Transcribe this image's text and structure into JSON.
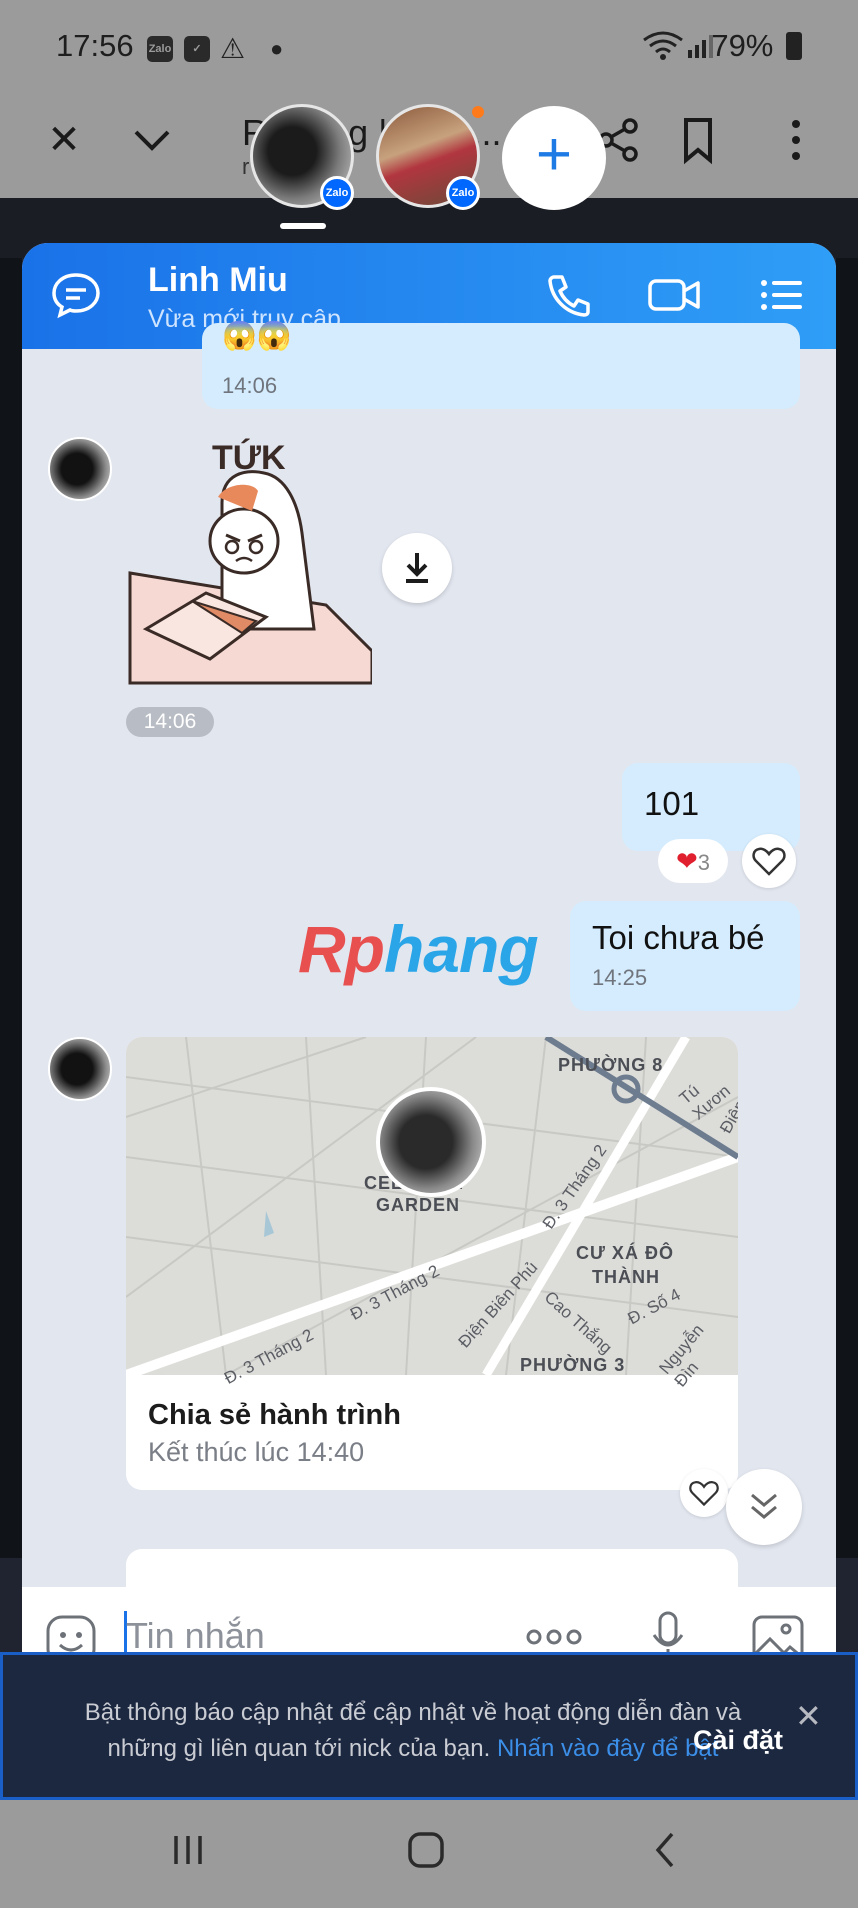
{
  "status_bar": {
    "time": "17:56",
    "battery": "79%",
    "zalo_badge": "Zalo"
  },
  "browser": {
    "title": "Rphang | Diễn...",
    "subtitle": "r"
  },
  "web": {
    "watermark_part1": "Rp",
    "watermark_part2": "hang"
  },
  "chat": {
    "contact_name": "Linh Miu",
    "contact_status": "Vừa mới truy cập",
    "messages": {
      "prev_time": "14:06",
      "sticker_text": "TỨK",
      "sticker_time": "14:06",
      "m101_text": "101",
      "m101_reaction_count": "3",
      "toi_text": "Toi chưa bé",
      "toi_time": "14:25"
    },
    "map": {
      "label_phuong8": "PHƯỜNG 8",
      "label_tuxuong": "Tú Xươn",
      "label_garden_1": "CELADA A",
      "label_garden_2": "GARDEN",
      "label_3thang2_a": "Đ. 3 Tháng 2",
      "label_3thang2_b": "Đ. 3 Tháng 2",
      "label_3thang2_c": "Đ. 3 Tháng 2",
      "label_cuxa_1": "CƯ XÁ ĐÔ",
      "label_cuxa_2": "THÀNH",
      "label_dienbien": "Điện Biên Phủ",
      "label_caothang": "Cao Thắng",
      "label_so4": "Đ. Số 4",
      "label_nguyendinh": "Nguyễn Đìn",
      "label_phuong3": "PHƯỜNG 3",
      "label_dien": "Điện"
    },
    "share_card": {
      "title": "Chia sẻ hành trình",
      "subtitle": "Kết thúc lúc 14:40"
    },
    "input": {
      "placeholder": "Tin nhắn"
    }
  },
  "notification": {
    "text": "Bật thông báo cập nhật để cập nhật về hoạt động diễn đàn và những gì liên quan tới nick của bạn. ",
    "link": "Nhấn vào đây để bật",
    "button": "Cài đặt",
    "close": "✕"
  },
  "colors": {
    "header_blue": "#1a72e8",
    "bubble_blue": "#d4ecfd",
    "chat_bg": "#e2e6ef"
  }
}
